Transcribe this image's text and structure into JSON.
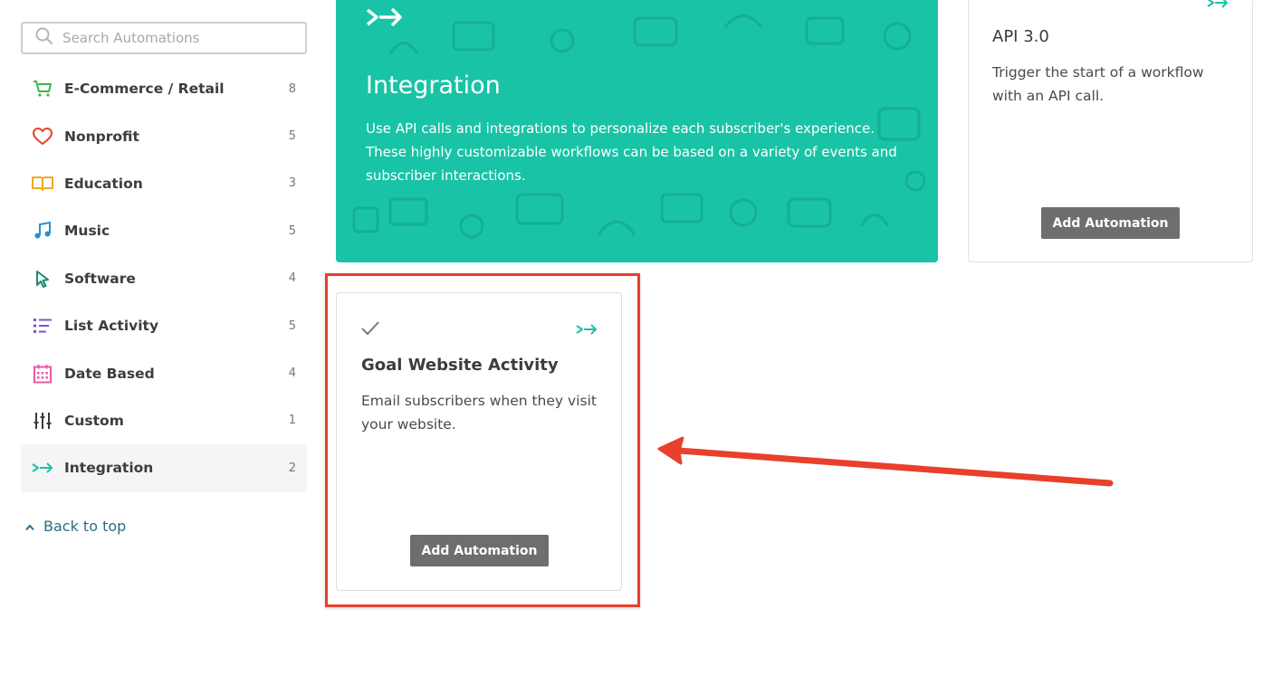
{
  "search": {
    "placeholder": "Search Automations"
  },
  "sidebar": {
    "items": [
      {
        "label": "E-Commerce / Retail",
        "count": "8",
        "icon": "cart-icon",
        "color": "#3db54a"
      },
      {
        "label": "Nonprofit",
        "count": "5",
        "icon": "heart-icon",
        "color": "#e8402c"
      },
      {
        "label": "Education",
        "count": "3",
        "icon": "book-icon",
        "color": "#f0a824"
      },
      {
        "label": "Music",
        "count": "5",
        "icon": "music-note-icon",
        "color": "#2a8fd0"
      },
      {
        "label": "Software",
        "count": "4",
        "icon": "cursor-icon",
        "color": "#1f8a6e"
      },
      {
        "label": "List Activity",
        "count": "5",
        "icon": "list-icon",
        "color": "#7e57c2"
      },
      {
        "label": "Date Based",
        "count": "4",
        "icon": "calendar-icon",
        "color": "#e85aa4"
      },
      {
        "label": "Custom",
        "count": "1",
        "icon": "sliders-icon",
        "color": "#3b3b3b"
      },
      {
        "label": "Integration",
        "count": "2",
        "icon": "integration-arrow-icon",
        "color": "#19c3a6"
      }
    ],
    "back_to_top": "Back to top"
  },
  "hero": {
    "title": "Integration",
    "description": "Use API calls and integrations to personalize each subscriber's experience. These highly customizable workflows can be based on a variety of events and subscriber interactions.",
    "color": "#19c3a6"
  },
  "cards": [
    {
      "title": "API 3.0",
      "description": "Trigger the start of a workflow with an API call.",
      "button": "Add Automation"
    },
    {
      "title": "Goal Website Activity",
      "description": "Email subscribers when they visit your website.",
      "button": "Add Automation"
    }
  ],
  "annotation_color": "#e8402c"
}
